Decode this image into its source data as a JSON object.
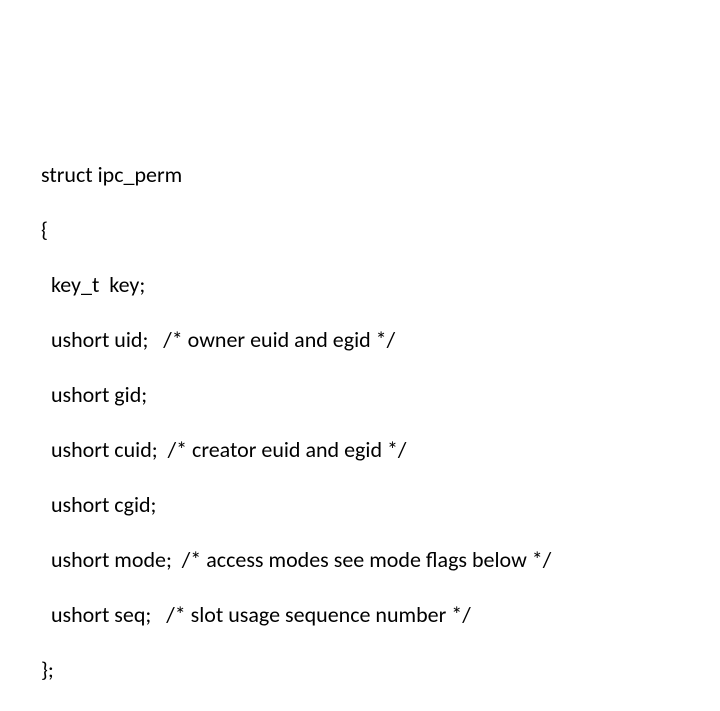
{
  "code": {
    "line1": "struct ipc_perm",
    "line2": "{",
    "line3": "  key_t  key;",
    "line4": "  ushort uid;   /* owner euid and egid */",
    "line5": "  ushort gid;",
    "line6": "  ushort cuid;  /* creator euid and egid */",
    "line7": "  ushort cgid;",
    "line8": "  ushort mode;  /* access modes see mode flags below */",
    "line9": "  ushort seq;   /* slot usage sequence number */",
    "line10": "};"
  }
}
